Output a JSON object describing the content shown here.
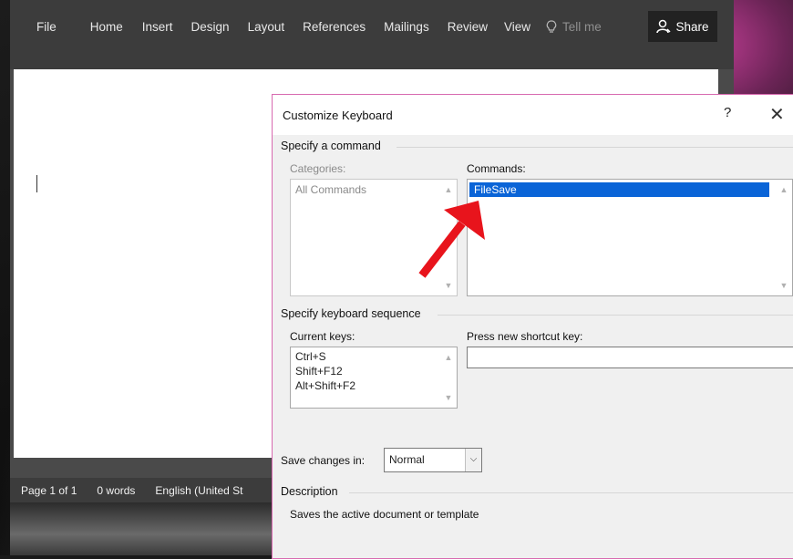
{
  "ribbon": {
    "tabs": [
      "File",
      "Home",
      "Insert",
      "Design",
      "Layout",
      "References",
      "Mailings",
      "Review",
      "View"
    ],
    "tell_me": "Tell me",
    "share": "Share",
    "tell_me_icon": "lightbulb-icon",
    "share_icon": "person-icon"
  },
  "status": {
    "page": "Page 1 of 1",
    "words": "0 words",
    "language": "English (United St"
  },
  "dialog": {
    "title": "Customize Keyboard",
    "help": "?",
    "close": "✕",
    "specify_command": "Specify a command",
    "categories_label": "Categories:",
    "categories": [
      "All Commands"
    ],
    "commands_label": "Commands:",
    "commands": [
      "FileSave"
    ],
    "specify_sequence": "Specify keyboard sequence",
    "current_keys_label": "Current keys:",
    "current_keys": [
      "Ctrl+S",
      "Shift+F12",
      "Alt+Shift+F2"
    ],
    "press_new_label": "Press new shortcut key:",
    "press_new_value": "",
    "save_changes_label": "Save changes in:",
    "save_changes_value": "Normal",
    "description_heading": "Description",
    "description_text": "Saves the active document or template"
  },
  "colors": {
    "selection": "#0a64d7",
    "annotation_arrow": "#e8141c",
    "dialog_border": "#d86ab0"
  }
}
